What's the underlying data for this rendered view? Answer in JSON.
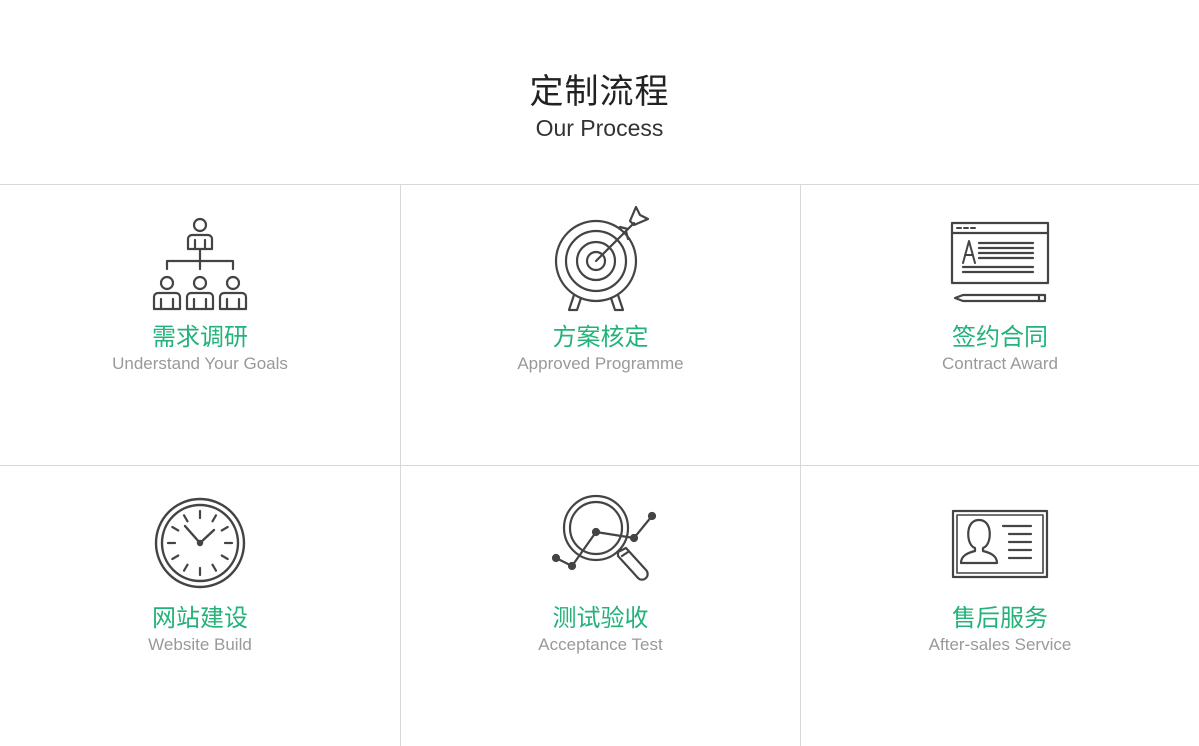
{
  "header": {
    "title_cn": "定制流程",
    "title_en": "Our Process"
  },
  "colors": {
    "accent": "#23b27a",
    "icon_stroke": "#444444",
    "subtitle": "#999999",
    "divider": "#d8d8d8"
  },
  "steps": [
    {
      "icon": "org-chart-icon",
      "title_cn": "需求调研",
      "title_en": "Understand Your Goals"
    },
    {
      "icon": "target-icon",
      "title_cn": "方案核定",
      "title_en": "Approved Programme"
    },
    {
      "icon": "contract-document-icon",
      "title_cn": "签约合同",
      "title_en": "Contract Award"
    },
    {
      "icon": "clock-icon",
      "title_cn": "网站建设",
      "title_en": "Website Build"
    },
    {
      "icon": "magnifier-chart-icon",
      "title_cn": "测试验收",
      "title_en": "Acceptance Test"
    },
    {
      "icon": "id-card-icon",
      "title_cn": "售后服务",
      "title_en": "After-sales Service"
    }
  ]
}
